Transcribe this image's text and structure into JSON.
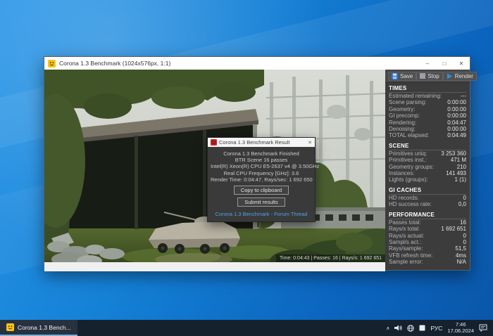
{
  "window": {
    "title": "Corona 1.3 Benchmark (1024x576px, 1:1)",
    "controls": {
      "minimize": "–",
      "maximize": "□",
      "close": "✕"
    }
  },
  "viewport": {
    "status": "Time: 0:04:43 | Passes: 16 | Rays/s: 1 692 651"
  },
  "panel": {
    "toolbar": {
      "save": "Save",
      "stop": "Stop",
      "render": "Render"
    },
    "times": {
      "title": "TIMES",
      "rows": [
        {
          "label": "Estimated remaining:",
          "value": "---"
        },
        {
          "label": "Scene parsing:",
          "value": "0:00:00"
        },
        {
          "label": "Geometry:",
          "value": "0:00:00"
        },
        {
          "label": "GI precomp:",
          "value": "0:00:00"
        },
        {
          "label": "Rendering:",
          "value": "0:04:47"
        },
        {
          "label": "Denoising:",
          "value": "0:00:00"
        },
        {
          "label": "TOTAL elapsed:",
          "value": "0:04:49"
        }
      ]
    },
    "scene": {
      "title": "SCENE",
      "rows": [
        {
          "label": "Primitives uniq:",
          "value": "3 253 360"
        },
        {
          "label": "Primitives inst.:",
          "value": "471 M"
        },
        {
          "label": "Geometry groups:",
          "value": "210"
        },
        {
          "label": "Instances:",
          "value": "141 493"
        },
        {
          "label": "Lights (groups):",
          "value": "1 (1)"
        }
      ]
    },
    "gi_caches": {
      "title": "GI CACHES",
      "rows": [
        {
          "label": "HD records:",
          "value": "0"
        },
        {
          "label": "HD success rate:",
          "value": "0,0"
        }
      ]
    },
    "performance": {
      "title": "PERFORMANCE",
      "rows": [
        {
          "label": "Passes total:",
          "value": "16"
        },
        {
          "label": "Rays/s total:",
          "value": "1 692 651"
        },
        {
          "label": "Rays/s actual:",
          "value": "0"
        },
        {
          "label": "Sampl/s act.:",
          "value": "0"
        },
        {
          "label": "Rays/sample:",
          "value": "51,5"
        },
        {
          "label": "VFB refresh time:",
          "value": "4ms"
        },
        {
          "label": "Sample error:",
          "value": "N/A"
        }
      ]
    }
  },
  "dialog": {
    "title": "Corona 1.3 Benchmark Result",
    "close_glyph": "✕",
    "lines": [
      "Corona 1.3 Benchmark Finished",
      "BTR Scene 16 passes",
      "Intel(R) Xeon(R) CPU E5-2637 v4 @ 3.50GHz",
      "Real CPU Frequency [GHz]: 3.6",
      "Render Time: 0:04:47, Rays/sec: 1 692 650"
    ],
    "buttons": [
      "Copy to clipboard",
      "Submit results"
    ],
    "link": "Corona 1.3 Benchmark - Forum Thread"
  },
  "taskbar": {
    "app_label": "Corona 1.3 Bench...",
    "tray": {
      "chevron": "∧",
      "lang": "РУС",
      "time": "7:46",
      "date": "17.06.2024"
    }
  },
  "colors": {
    "accent_blue": "#2f8fdd",
    "panel_bg": "#3c3c3c",
    "dialog_bg": "#3a3a3a",
    "link_blue": "#4da3e8",
    "taskbar_bg": "#16212e",
    "desktop_blue_top": "#2a97e8",
    "desktop_blue_bottom": "#0a56a8"
  }
}
